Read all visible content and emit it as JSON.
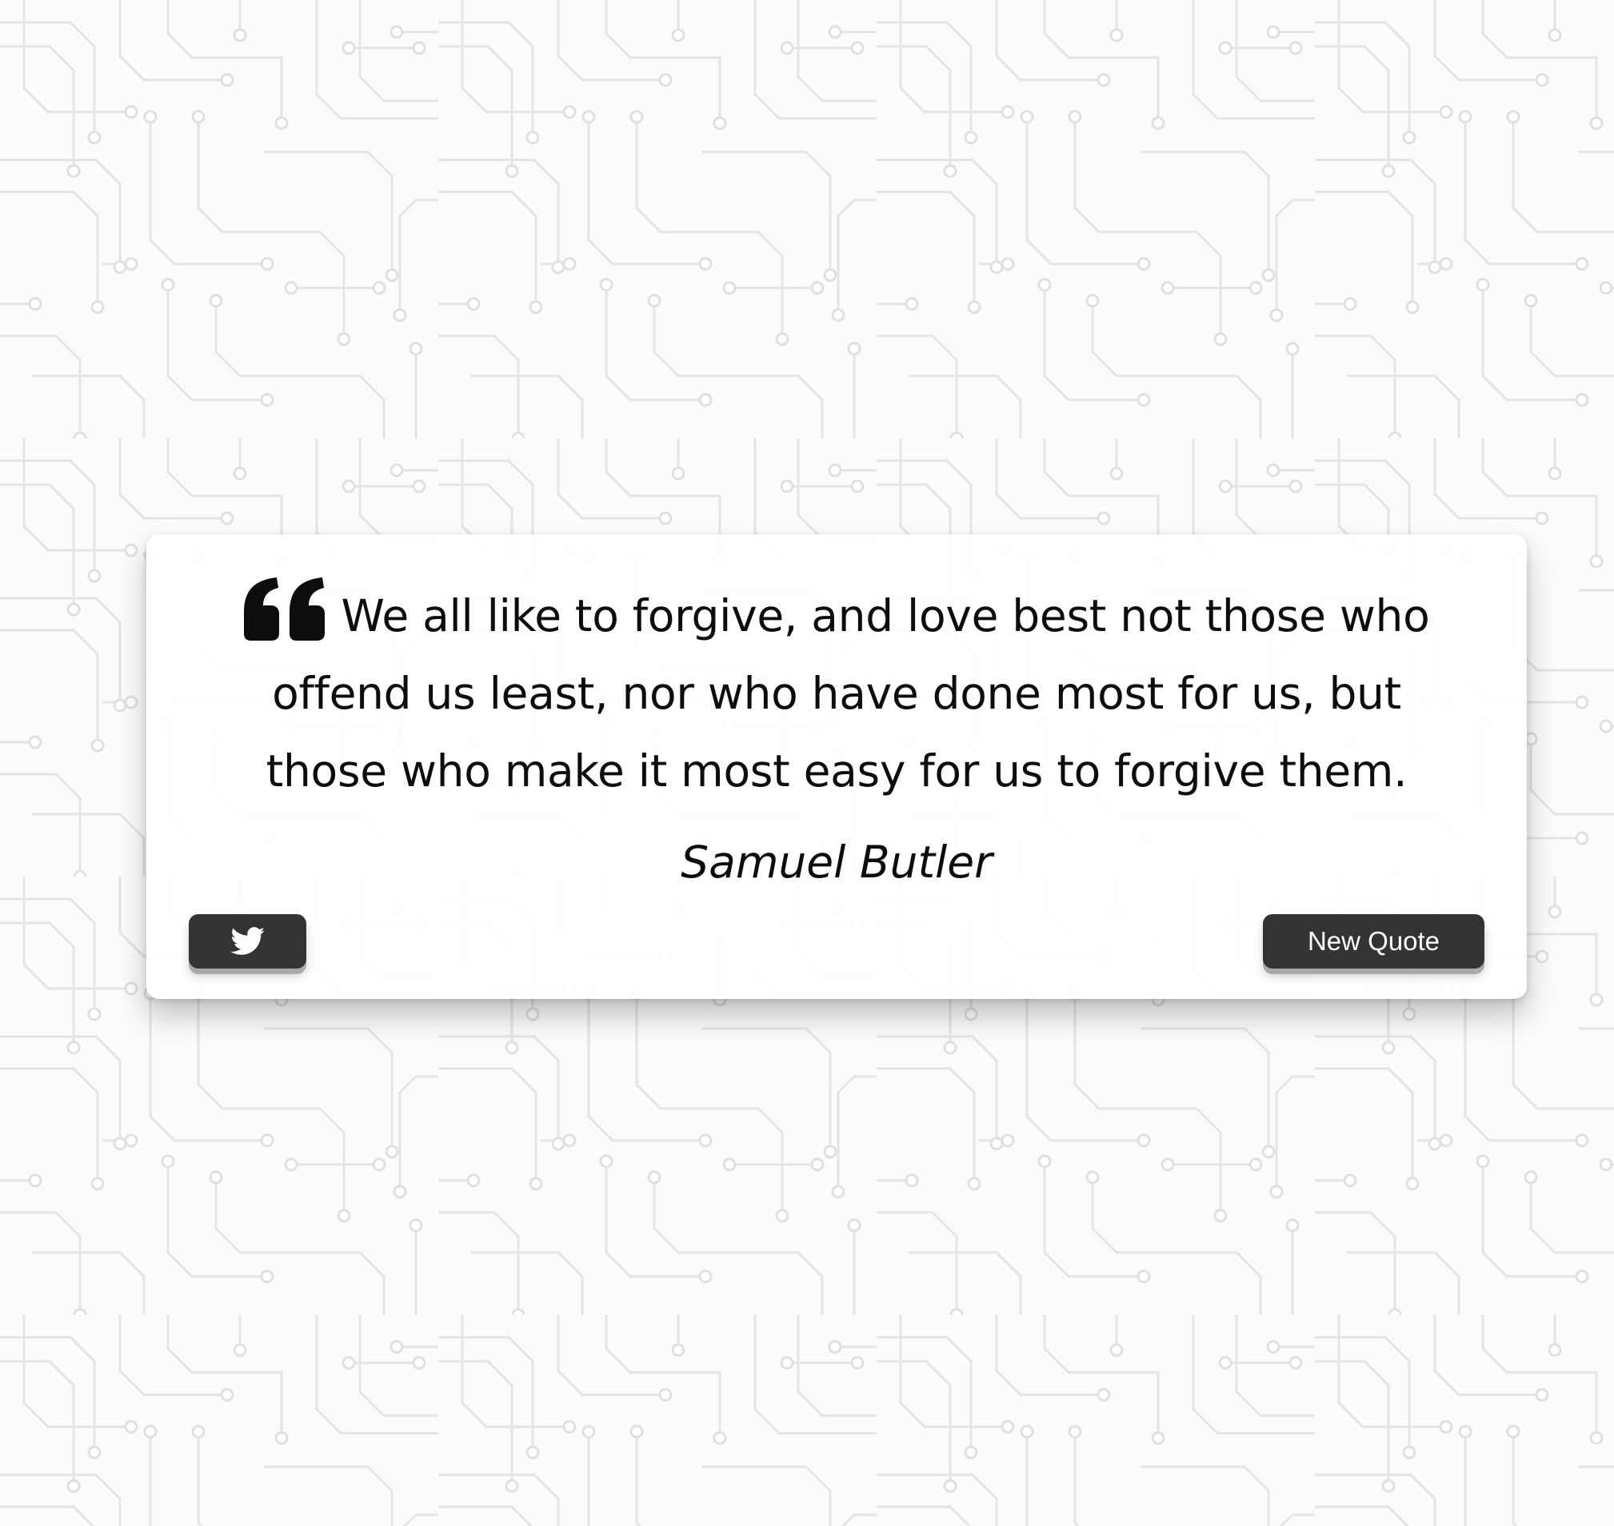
{
  "quote": {
    "icon": "quote-left-icon",
    "text": "We all like to forgive, and love best not those who offend us least, nor who have done most for us, but those who make it most easy for us to forgive them.",
    "author": "Samuel Butler"
  },
  "actions": {
    "tweet_icon": "twitter-icon",
    "new_quote_label": "New Quote"
  },
  "colors": {
    "button_bg": "#333333",
    "button_text": "#ffffff",
    "text": "#0d0d0d",
    "card_bg": "#ffffff",
    "pattern": "#e5e5e5"
  }
}
